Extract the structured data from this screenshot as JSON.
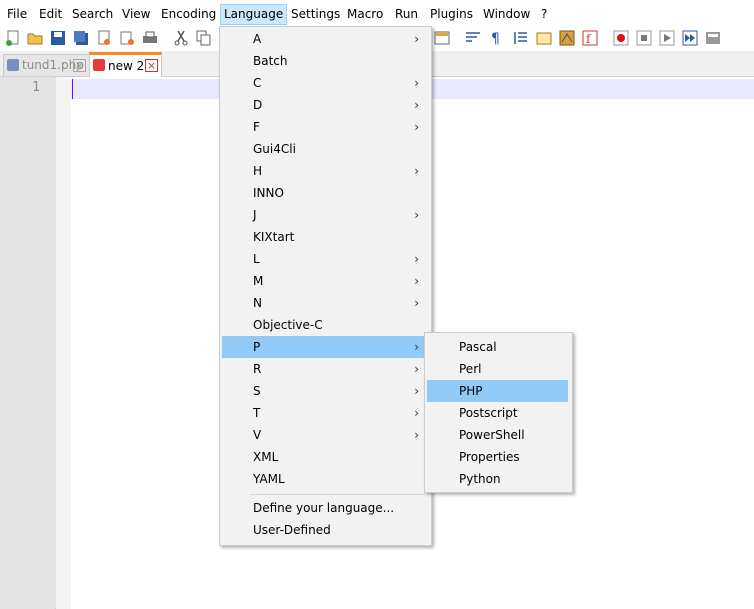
{
  "menubar": {
    "file": "File",
    "edit": "Edit",
    "search": "Search",
    "view": "View",
    "encoding": "Encoding",
    "language": "Language",
    "settings": "Settings",
    "macro": "Macro",
    "run": "Run",
    "plugins": "Plugins",
    "window": "Window",
    "help": "?"
  },
  "tabs": {
    "tab1": "tund1.php",
    "tab2": "new 2"
  },
  "editor": {
    "line1": "1"
  },
  "language_menu": {
    "items": [
      "A",
      "Batch",
      "C",
      "D",
      "F",
      "Gui4Cli",
      "H",
      "INNO",
      "J",
      "KIXtart",
      "L",
      "M",
      "N",
      "Objective-C",
      "P",
      "R",
      "S",
      "T",
      "V",
      "XML",
      "YAML"
    ],
    "define": "Define your language...",
    "user_defined": "User-Defined",
    "highlighted": "P",
    "submenu_arrow": "›"
  },
  "p_submenu": {
    "items": [
      "Pascal",
      "Perl",
      "PHP",
      "Postscript",
      "PowerShell",
      "Properties",
      "Python"
    ],
    "highlighted": "PHP"
  },
  "colors": {
    "menu_highlight": "#91c9f7",
    "active_tab_accent": "#fa8b25",
    "current_line": "#e8e8ff"
  }
}
